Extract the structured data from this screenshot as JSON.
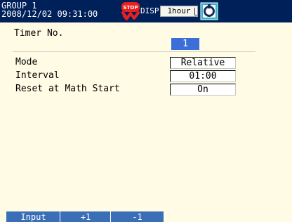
{
  "header": {
    "group": "GROUP 1",
    "datetime": "2008/12/02 09:31:00",
    "stop_icon": "stop-status-icon",
    "stop_icon_text": "STOP",
    "disp_label": "DISP",
    "time_div": "1hour",
    "memory_icon": "memory-card-icon",
    "colors": {
      "bar": "#00205a",
      "stop": "#e82020"
    }
  },
  "settings": {
    "timer_no_label": "Timer No.",
    "timer_no_value": "1",
    "mode_label": "Mode",
    "mode_value": "Relative",
    "interval_label": "Interval",
    "interval_value": "01:00",
    "reset_label": "Reset at Math Start",
    "reset_value": "On"
  },
  "softkeys": {
    "input": "Input",
    "plus": "+1",
    "minus": "-1",
    "color": "#3a6fb8"
  },
  "colors": {
    "background": "#fffbe4",
    "selection": "#3b6ed8"
  }
}
